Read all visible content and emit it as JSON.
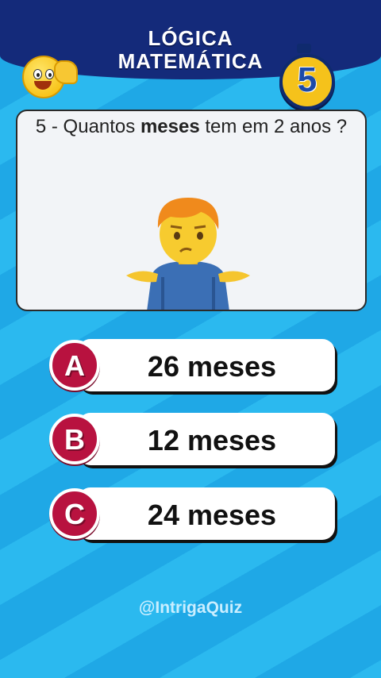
{
  "header": {
    "title_line1": "LÓGICA",
    "title_line2": "MATEMÁTICA",
    "timer_value": "5",
    "emoji_icon": "winking-face-emoji",
    "timer_icon": "stopwatch-icon"
  },
  "question": {
    "prefix": "5 - Quantos ",
    "bold": "meses",
    "suffix": " tem em 2 anos ?",
    "illustration": "person-shrugging-emoji"
  },
  "answers": [
    {
      "letter": "A",
      "text": "26 meses"
    },
    {
      "letter": "B",
      "text": "12 meses"
    },
    {
      "letter": "C",
      "text": "24 meses"
    }
  ],
  "footer": {
    "handle": "@IntrigaQuiz"
  },
  "colors": {
    "header_bg": "#142a7a",
    "background": "#29b6ec",
    "badge": "#b8123f",
    "timer": "#f5c21b"
  }
}
